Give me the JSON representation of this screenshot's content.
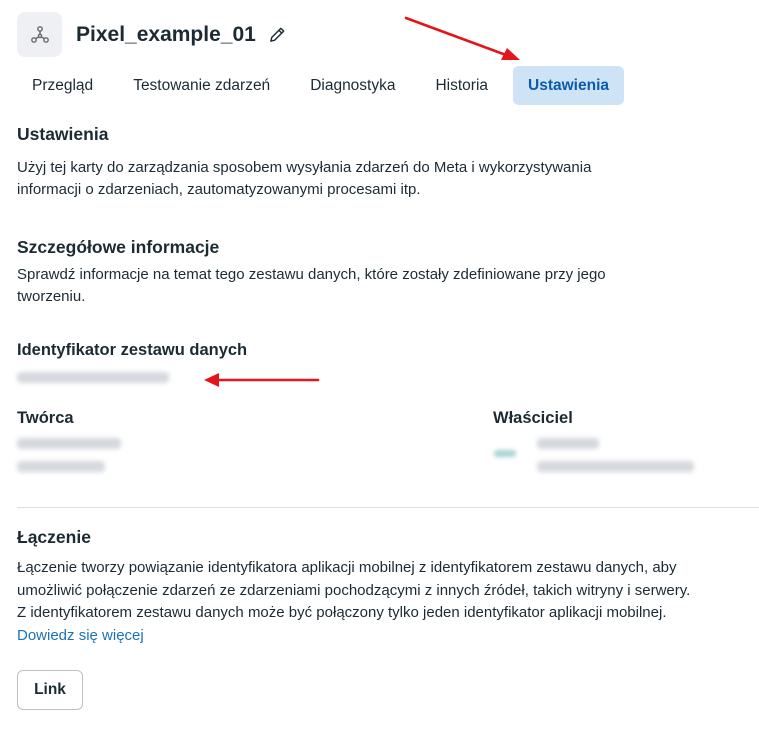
{
  "header": {
    "title": "Pixel_example_01"
  },
  "tabs": [
    {
      "label": "Przegląd"
    },
    {
      "label": "Testowanie zdarzeń"
    },
    {
      "label": "Diagnostyka"
    },
    {
      "label": "Historia"
    },
    {
      "label": "Ustawienia",
      "active": true
    }
  ],
  "settings": {
    "heading": "Ustawienia",
    "desc_line1": "Użyj tej karty do zarządzania sposobem wysyłania zdarzeń do Meta i wykorzystywania",
    "desc_line2": "informacji o zdarzeniach, zautomatyzowanymi procesami itp."
  },
  "details": {
    "heading": "Szczegółowe informacje",
    "desc_line1": "Sprawdź informacje na temat tego zestawu danych, które zostały zdefiniowane przy jego",
    "desc_line2": "tworzeniu."
  },
  "dataset_id": {
    "label": "Identyfikator zestawu danych"
  },
  "creator": {
    "label": "Twórca"
  },
  "owner": {
    "label": "Właściciel"
  },
  "linking": {
    "heading": "Łączenie",
    "line1": "Łączenie tworzy powiązanie identyfikatora aplikacji mobilnej z identyfikatorem zestawu danych, aby",
    "line2": "umożliwić połączenie zdarzeń ze zdarzeniami pochodzącymi z innych źródeł, takich witryny i serwery.",
    "line3": "Z identyfikatorem zestawu danych może być połączony tylko jeden identyfikator aplikacji mobilnej.",
    "learn_more": "Dowiedz się więcej",
    "button_label": "Link"
  },
  "colors": {
    "active_tab_bg": "#cfe3f7",
    "active_tab_text": "#0b5cad",
    "link": "#1a73b8",
    "annotation_arrow": "#e3161b"
  }
}
